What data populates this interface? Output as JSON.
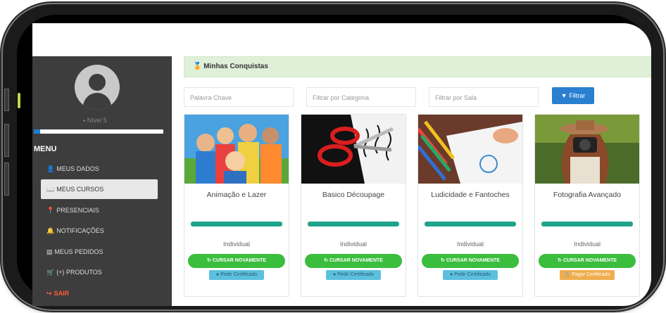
{
  "sidebar": {
    "level": "Nível 5",
    "progress": 0.05,
    "menu_title": "MENU",
    "items": [
      {
        "icon": "user-icon",
        "glyph": "👤",
        "label": "MEUS DADOS"
      },
      {
        "icon": "cursos-icon",
        "glyph": "📖",
        "label": "MEUS CURSOS"
      },
      {
        "icon": "map-marker-icon",
        "glyph": "📍",
        "label": "PRESENCIAIS"
      },
      {
        "icon": "bell-icon",
        "glyph": "🔔",
        "label": "NOTIFICAÇÕES"
      },
      {
        "icon": "list-icon",
        "glyph": "▤",
        "label": "MEUS PEDIDOS"
      },
      {
        "icon": "cart-icon",
        "glyph": "🛒",
        "label": "(+) PRODUTOS"
      },
      {
        "icon": "sign-out-icon",
        "glyph": "↪",
        "label": "SAIR"
      }
    ]
  },
  "main": {
    "header_icon": "trophy-icon",
    "header_title": "Minhas Conquistas",
    "filters": {
      "keyword_placeholder": "Palavra Chave",
      "category_placeholder": "Filtrar por Categoria",
      "room_placeholder": "Filtrar por Sala",
      "button_label": "Filtrar"
    },
    "cards": [
      {
        "title": "Animação e Lazer",
        "mode": "Individual",
        "again_label": "CURSAR NOVAMENTE",
        "cert_label": "Pedir Certificado",
        "cert_type": "request",
        "progress": 1.0
      },
      {
        "title": "Basico Découpage",
        "mode": "Individual",
        "again_label": "CURSAR NOVAMENTE",
        "cert_label": "Pedir Certificado",
        "cert_type": "request",
        "progress": 1.0
      },
      {
        "title": "Ludicidade e Fantoches",
        "mode": "Individual",
        "again_label": "CURSAR NOVAMENTE",
        "cert_label": "Pedir Certificado",
        "cert_type": "request",
        "progress": 1.0
      },
      {
        "title": "Fotografia Avançado",
        "mode": "Individual",
        "again_label": "CURSAR NOVAMENTE",
        "cert_label": "Pagar Certificado",
        "cert_type": "pay",
        "progress": 1.0
      }
    ]
  },
  "colors": {
    "sidebar_bg": "#3d3d3d",
    "header_bg": "#dff0d8",
    "primary": "#2a7fd0",
    "success": "#3bbd3d",
    "bar": "#1fa48a",
    "info": "#5bc0de",
    "warning": "#f0ad4e",
    "danger": "#ff5a3c"
  }
}
